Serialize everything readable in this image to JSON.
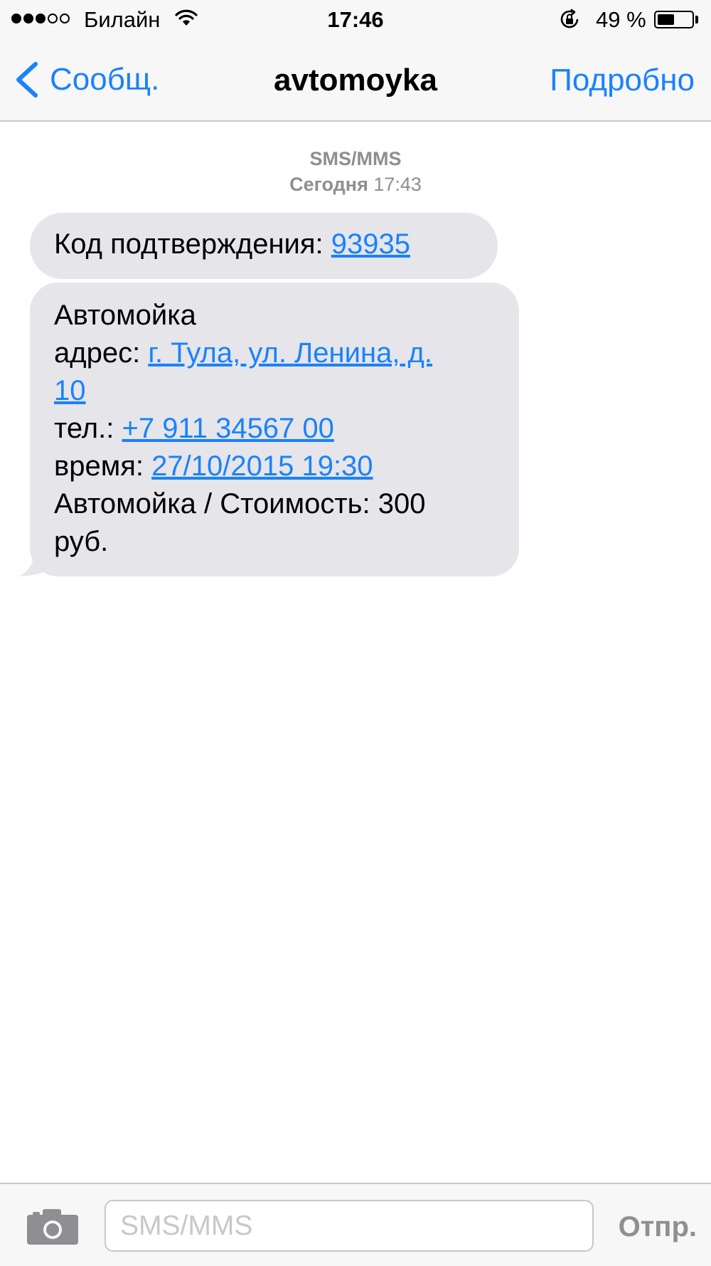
{
  "status_bar": {
    "carrier": "Билайн",
    "signal_bars_total": 5,
    "signal_bars_filled": 3,
    "time": "17:46",
    "battery_percent": "49 %",
    "battery_level": 0.49
  },
  "nav": {
    "back_label": "Сообщ.",
    "title": "avtomoyka",
    "details_label": "Подробно"
  },
  "conversation": {
    "type_label": "SMS/MMS",
    "day_label": "Сегодня",
    "time_label": "17:43"
  },
  "messages": [
    {
      "code_prefix": "Код подтверждения: ",
      "code": "93935"
    },
    {
      "line1": "Автомойка",
      "address_prefix": "адрес: ",
      "address_part1": "г. Тула, ул. Ленина, д.",
      "address_part2": "10",
      "phone_prefix": "тел.: ",
      "phone": "+7 911 34567 00",
      "time_prefix": "время: ",
      "datetime": "27/10/2015 19:30",
      "cost_line1": "Автомойка / Стоимость: 300",
      "cost_line2": "руб."
    }
  ],
  "input_bar": {
    "placeholder": "SMS/MMS",
    "value": "",
    "send_label": "Отпр."
  },
  "colors": {
    "accent": "#1a82fb",
    "bubble": "#e5e5ea",
    "bar_background": "#f7f7f7",
    "muted_text": "#8e8e93"
  }
}
